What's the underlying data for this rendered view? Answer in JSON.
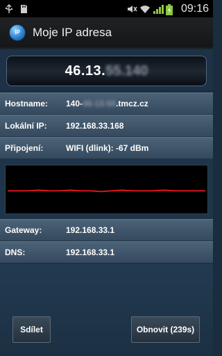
{
  "status_bar": {
    "time": "09:16",
    "icons": [
      "usb-icon",
      "sd-card-icon",
      "mute-icon",
      "wifi-icon",
      "signal-icon",
      "battery-charging-icon"
    ]
  },
  "action_bar": {
    "app_icon_text": "IP",
    "title": "Moje IP adresa"
  },
  "ip": {
    "visible": "46.13.",
    "hidden": "55.140"
  },
  "rows": {
    "hostname": {
      "label": "Hostname:",
      "value_prefix": "140-",
      "value_hidden": "46-13-55",
      "value_suffix": ".tmcz.cz"
    },
    "local_ip": {
      "label": "Lokální IP:",
      "value": "192.168.33.168"
    },
    "connection": {
      "label": "Připojení:",
      "value": "WIFI  (dlink): -67 dBm"
    },
    "gateway": {
      "label": "Gateway:",
      "value": "192.168.33.1"
    },
    "dns": {
      "label": "DNS:",
      "value": "192.168.33.1"
    }
  },
  "graph": {
    "line_color": "#e8161b",
    "signal_dbm": [
      -67,
      -67,
      -67,
      -66,
      -67,
      -67,
      -66,
      -67,
      -67,
      -68,
      -67,
      -66,
      -67,
      -67,
      -67,
      -66,
      -67,
      -67,
      -67,
      -67
    ]
  },
  "buttons": {
    "share": "Sdílet",
    "refresh": "Obnovit (239s)"
  }
}
